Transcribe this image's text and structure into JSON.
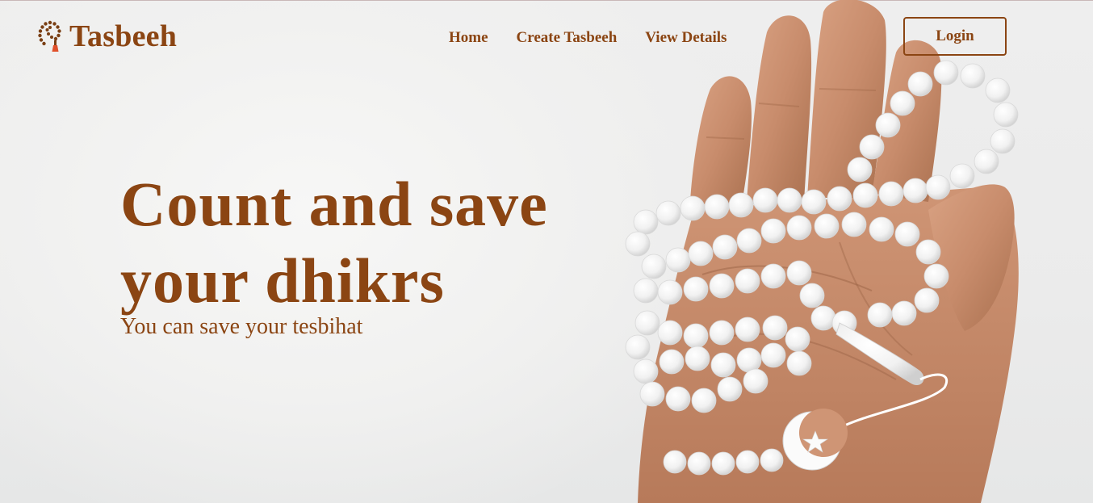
{
  "brand": {
    "name": "Tasbeeh",
    "logo_icon": "prayer-beads-icon",
    "color": "#8b4513"
  },
  "nav": {
    "items": [
      {
        "label": "Home"
      },
      {
        "label": "Create Tasbeeh"
      },
      {
        "label": "View Details"
      }
    ]
  },
  "login": {
    "label": "Login"
  },
  "hero": {
    "title_line1": "Count and save",
    "title_line2": "your dhikrs",
    "subtitle": "You can save your tesbihat"
  },
  "colors": {
    "accent": "#8b4513",
    "background": "#ececec",
    "skin": "#c98e6f",
    "beads": "#fafafa"
  }
}
